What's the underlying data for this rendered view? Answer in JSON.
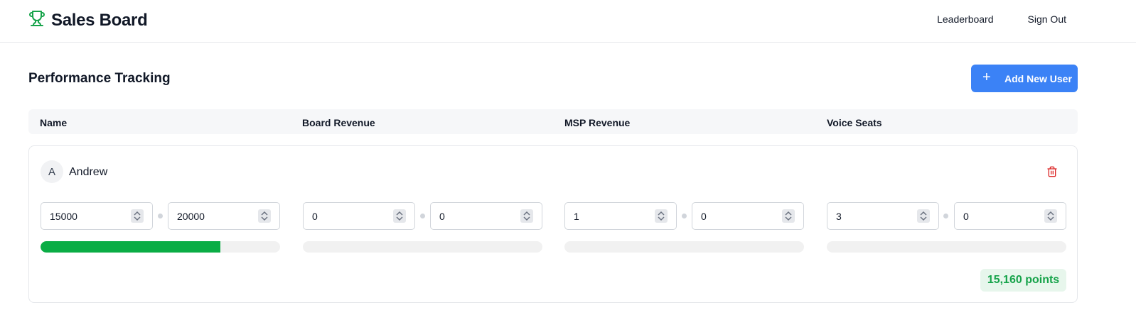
{
  "app": {
    "title": "Sales Board"
  },
  "nav": {
    "leaderboard": "Leaderboard",
    "sign_out": "Sign Out"
  },
  "page": {
    "title": "Performance Tracking",
    "add_user": "Add New User"
  },
  "columns": [
    "Name",
    "Board Revenue",
    "MSP Revenue",
    "Voice Seats"
  ],
  "users": [
    {
      "avatar": "A",
      "name": "Andrew",
      "board_revenue": {
        "actual": "15000",
        "target": "20000",
        "progress": 0.75
      },
      "msp_revenue": {
        "actual": "0",
        "target": "0",
        "progress": 0
      },
      "voice_seats": {
        "actual": "1",
        "target": "0",
        "progress": 0
      },
      "extra": {
        "actual": "3",
        "target": "0",
        "progress": 0
      },
      "points": "15,160 points"
    }
  ],
  "colors": {
    "accent": "#3b82f6",
    "brand_green": "#16a34a",
    "progress_fill": "#0aad45",
    "danger": "#dc2626"
  },
  "icons": {
    "brand": "trophy-icon",
    "add": "plus-icon",
    "delete": "trash-icon",
    "spinner": "spinner-arrows-icon"
  }
}
